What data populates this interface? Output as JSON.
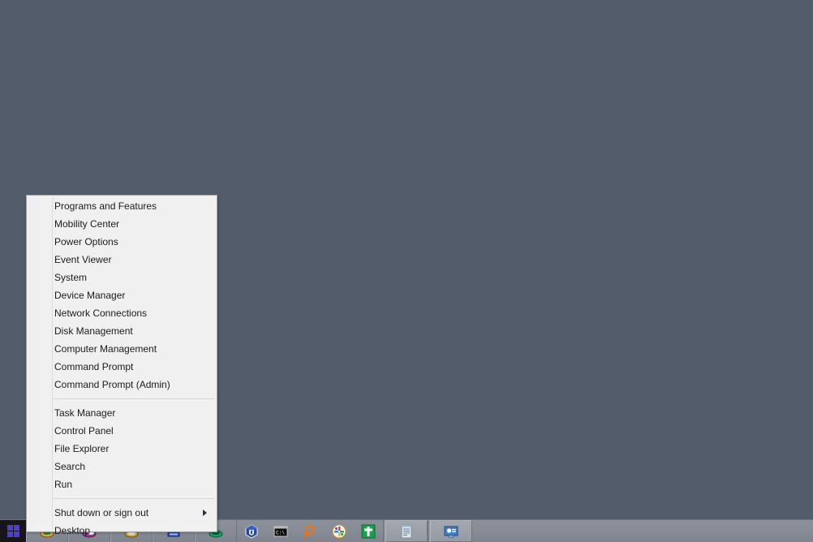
{
  "desktop": {
    "background_color": "#525c6b"
  },
  "power_menu": {
    "name": "Win+X Power User Menu",
    "background_color": "#f0f0f0",
    "border_color": "#a0a0a0",
    "groups": [
      {
        "items": [
          {
            "label": "Programs and Features",
            "has_submenu": false
          },
          {
            "label": "Mobility Center",
            "has_submenu": false
          },
          {
            "label": "Power Options",
            "has_submenu": false
          },
          {
            "label": "Event Viewer",
            "has_submenu": false
          },
          {
            "label": "System",
            "has_submenu": false
          },
          {
            "label": "Device Manager",
            "has_submenu": false
          },
          {
            "label": "Network Connections",
            "has_submenu": false
          },
          {
            "label": "Disk Management",
            "has_submenu": false
          },
          {
            "label": "Computer Management",
            "has_submenu": false
          },
          {
            "label": "Command Prompt",
            "has_submenu": false
          },
          {
            "label": "Command Prompt (Admin)",
            "has_submenu": false
          }
        ]
      },
      {
        "items": [
          {
            "label": "Task Manager",
            "has_submenu": false
          },
          {
            "label": "Control Panel",
            "has_submenu": false
          },
          {
            "label": "File Explorer",
            "has_submenu": false
          },
          {
            "label": "Search",
            "has_submenu": false
          },
          {
            "label": "Run",
            "has_submenu": false
          }
        ]
      },
      {
        "items": [
          {
            "label": "Shut down or sign out",
            "has_submenu": true
          },
          {
            "label": "Desktop",
            "has_submenu": false
          }
        ]
      }
    ]
  },
  "taskbar": {
    "background_color": "#878c96",
    "start_button": {
      "icon": "windows-logo-icon",
      "background_color": "#18141e",
      "logo_color": "#4b3fd0"
    },
    "quicklaunch_hidden_buttons": [
      {
        "icon": "app-icon-orange"
      },
      {
        "icon": "app-icon-purple"
      },
      {
        "icon": "app-icon-gold"
      },
      {
        "icon": "app-icon-blue"
      },
      {
        "icon": "app-icon-green"
      }
    ],
    "icons": [
      {
        "icon": "virtualbox-cube-icon",
        "label": "VirtualBox"
      },
      {
        "icon": "command-prompt-icon",
        "label": "Command Prompt"
      },
      {
        "icon": "search-magnifier-icon",
        "label": "Search"
      },
      {
        "icon": "pinwheel-globe-icon",
        "label": "Pinwheel"
      },
      {
        "icon": "green-cross-icon",
        "label": "Green Cross"
      }
    ],
    "task_buttons": [
      {
        "icon": "notepad-icon",
        "label": "Notepad",
        "pressed": true
      },
      {
        "icon": "remote-desktop-icon",
        "label": "Remote Desktop",
        "pressed": true
      }
    ]
  }
}
